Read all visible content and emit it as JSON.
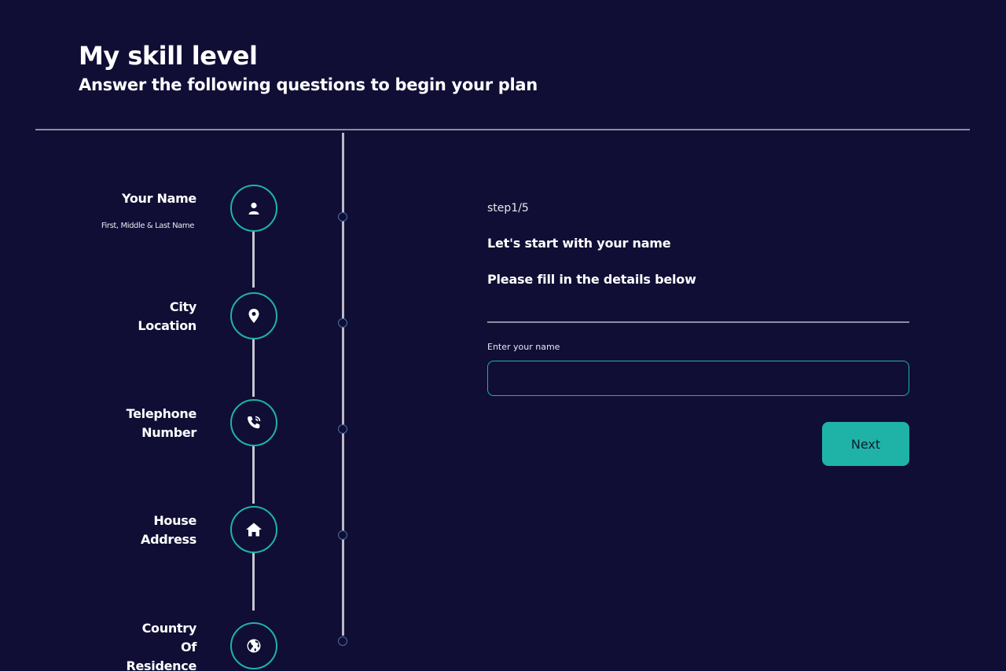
{
  "header": {
    "title": "My skill level",
    "subtitle": "Answer the following questions to begin your plan"
  },
  "steps": [
    {
      "label_lines": [
        "Your Name"
      ],
      "sublabel": "First, Middle & Last Name",
      "icon": "user-icon"
    },
    {
      "label_lines": [
        "City",
        "Location"
      ],
      "icon": "location-pin-icon"
    },
    {
      "label_lines": [
        "Telephone",
        "Number"
      ],
      "icon": "phone-icon"
    },
    {
      "label_lines": [
        "House",
        "Address"
      ],
      "icon": "home-icon"
    },
    {
      "label_lines": [
        "Country",
        "Of",
        "Residence"
      ],
      "icon": "globe-icon"
    }
  ],
  "form": {
    "step": "step1/5",
    "heading": "Let's start with your name",
    "subheading": "Please fill in the details below",
    "field_label": "Enter your name",
    "input_value": "",
    "next_label": "Next"
  },
  "colors": {
    "background": "#100e35",
    "accent": "#1fb3a8",
    "text": "#ffffff",
    "divider": "#8f8d9e"
  }
}
